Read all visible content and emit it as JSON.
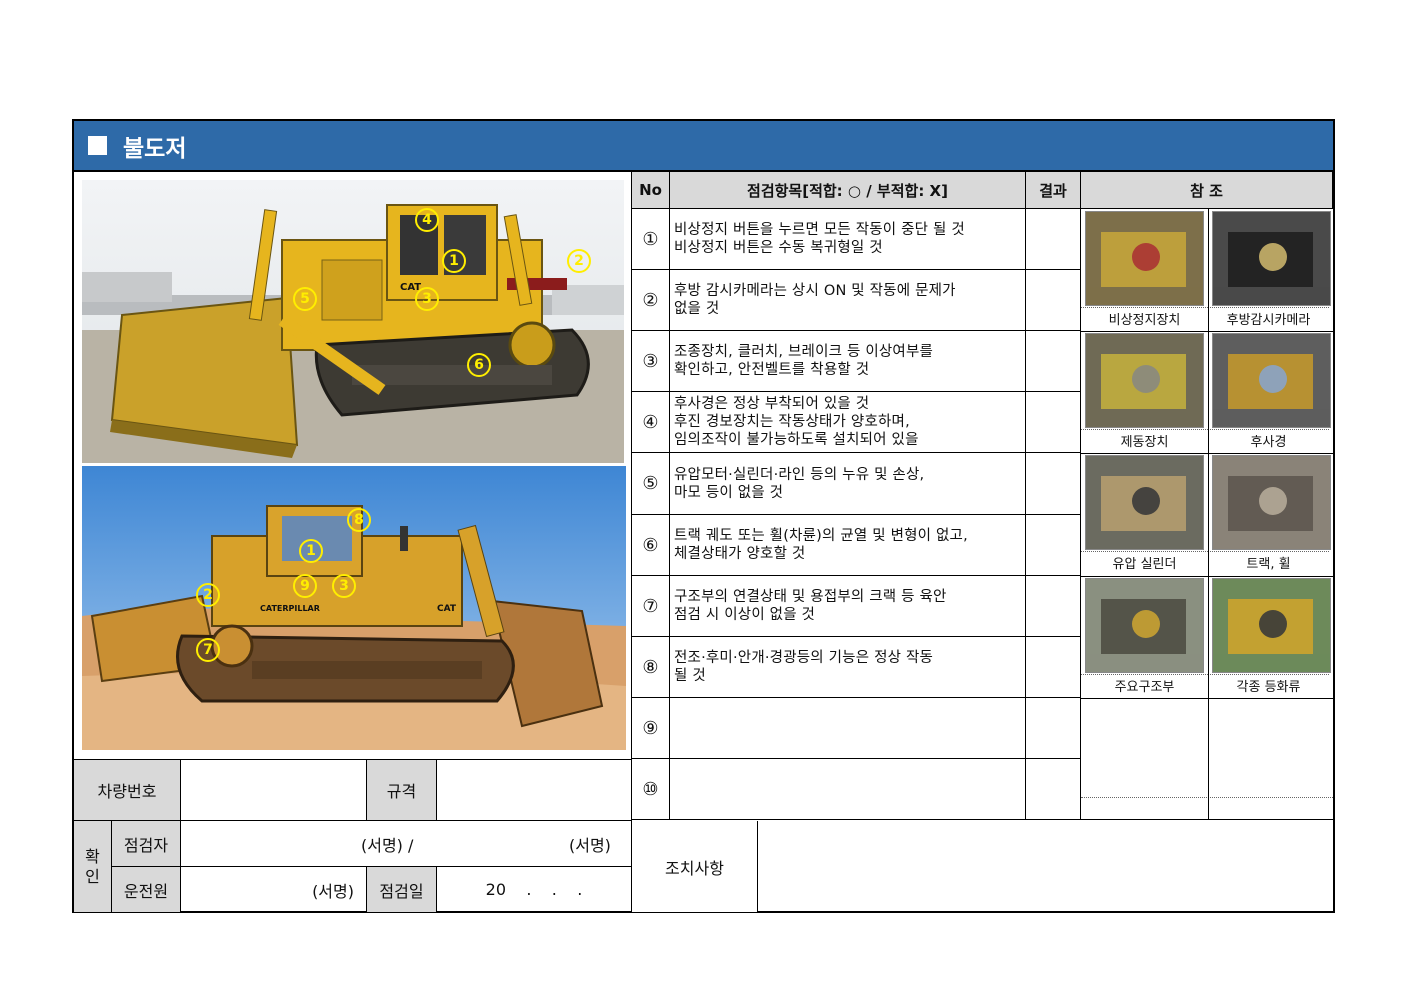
{
  "title": "불도저",
  "table_header": {
    "no": "No",
    "items": "점검항목[적합: ○ / 부적합: X]",
    "result": "결과",
    "reference": "참 조"
  },
  "items": [
    {
      "no": "①",
      "text": "비상정지 버튼을 누르면 모든 작동이 중단 될 것\n비상정지 버튼은 수동 복귀형일 것",
      "result": ""
    },
    {
      "no": "②",
      "text": "후방 감시카메라는 상시 ON 및 작동에 문제가\n없을 것",
      "result": ""
    },
    {
      "no": "③",
      "text": "조종장치, 클러치, 브레이크 등 이상여부를\n확인하고, 안전벨트를 착용할 것",
      "result": ""
    },
    {
      "no": "④",
      "text": "후사경은 정상 부착되어 있을 것\n후진 경보장치는 작동상태가 양호하며,\n임의조작이 불가능하도록 설치되어 있을",
      "result": ""
    },
    {
      "no": "⑤",
      "text": "유압모터·실린더·라인 등의 누유 및 손상,\n마모 등이 없을 것",
      "result": ""
    },
    {
      "no": "⑥",
      "text": "트랙 궤도 또는 휠(차륜)의 균열 및 변형이 없고,\n체결상태가 양호할 것",
      "result": ""
    },
    {
      "no": "⑦",
      "text": "구조부의 연결상태 및 용접부의 크랙 등 육안\n점검 시 이상이 없을 것",
      "result": ""
    },
    {
      "no": "⑧",
      "text": "전조·후미·안개·경광등의 기능은 정상 작동\n될 것",
      "result": ""
    },
    {
      "no": "⑨",
      "text": "",
      "result": ""
    },
    {
      "no": "⑩",
      "text": "",
      "result": ""
    }
  ],
  "references": [
    {
      "caption": "비상정지장치",
      "icon": "emergency-stop-photo"
    },
    {
      "caption": "후방감시카메라",
      "icon": "rear-camera-photo"
    },
    {
      "caption": "제동장치",
      "icon": "brake-photo"
    },
    {
      "caption": "후사경",
      "icon": "mirror-photo"
    },
    {
      "caption": "유압 실린더",
      "icon": "hydraulic-cylinder-photo"
    },
    {
      "caption": "트랙, 휠",
      "icon": "track-wheel-photo"
    },
    {
      "caption": "주요구조부",
      "icon": "main-structure-photo"
    },
    {
      "caption": "각종 등화류",
      "icon": "lights-photo"
    }
  ],
  "photo_markers_top": [
    "4",
    "1",
    "2",
    "5",
    "3",
    "6"
  ],
  "photo_markers_bottom": [
    "8",
    "1",
    "2",
    "9",
    "3",
    "7"
  ],
  "bulldozer_badges": {
    "top_brand": "CAT",
    "bottom_brand": "CATERPILLAR",
    "bottom_cat": "CAT"
  },
  "form": {
    "vehicle_no_label": "차량번호",
    "vehicle_no_value": "",
    "spec_label": "규격",
    "spec_value": "",
    "confirm_label": "확\n인",
    "inspector_label": "점검자",
    "inspector_sign_1": "(서명) /",
    "inspector_sign_2": "(서명)",
    "driver_label": "운전원",
    "driver_sign": "(서명)",
    "date_label": "점검일",
    "date_value": "20    .    .    .",
    "action_label": "조치사항",
    "action_value": ""
  },
  "colors": {
    "title_bar": "#2e6aa8",
    "header_gray": "#d9d9d9",
    "marker": "#ffee00",
    "bulldozer_yellow": "#e6b51e"
  }
}
